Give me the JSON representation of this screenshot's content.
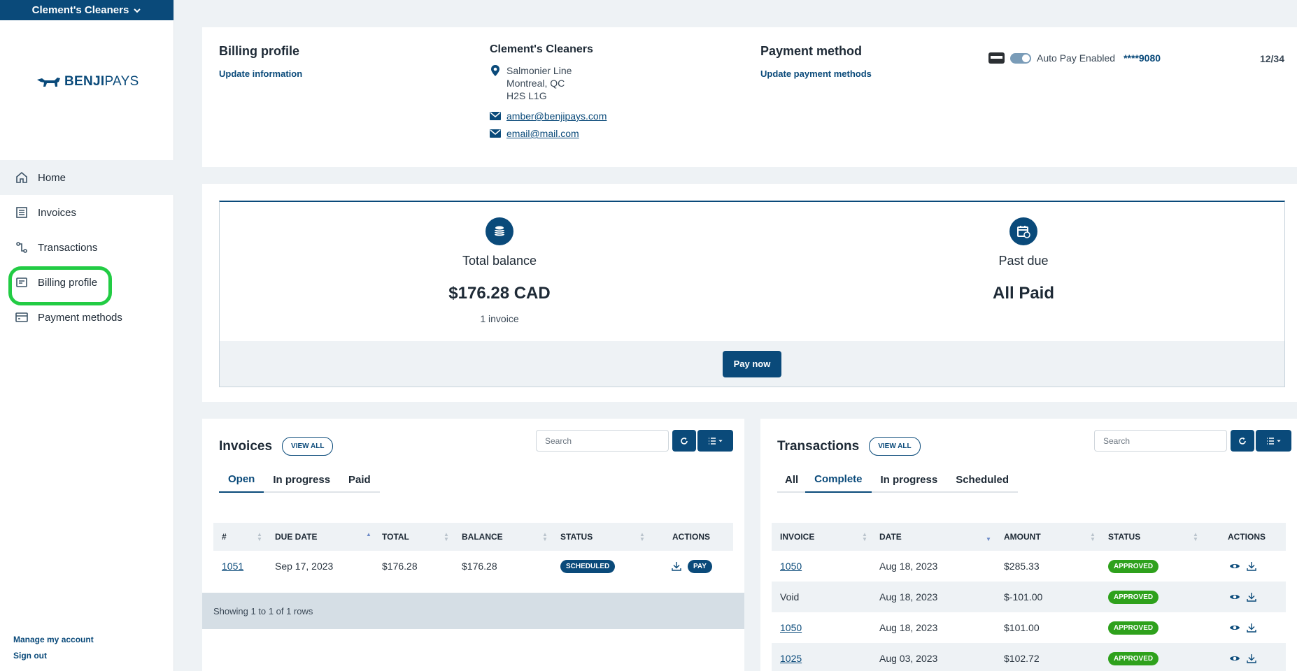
{
  "sidebar": {
    "company": "Clement's Cleaners",
    "logo_bold": "BENJI",
    "logo_light": "PAYS",
    "nav": [
      {
        "label": "Home",
        "icon": "home-icon"
      },
      {
        "label": "Invoices",
        "icon": "invoice-icon"
      },
      {
        "label": "Transactions",
        "icon": "transactions-icon"
      },
      {
        "label": "Billing profile",
        "icon": "billing-icon"
      },
      {
        "label": "Payment methods",
        "icon": "credit-card-icon"
      }
    ],
    "manage_account": "Manage my account",
    "sign_out": "Sign out"
  },
  "profile": {
    "title": "Billing profile",
    "update_info": "Update information",
    "company_name": "Clement's Cleaners",
    "address_line1": "Salmonier Line",
    "address_line2": "Montreal, QC",
    "address_line3": "H2S L1G",
    "email1": "amber@benjipays.com",
    "email2": "email@mail.com",
    "payment_title": "Payment method",
    "update_payment": "Update payment methods",
    "autopay_label": "Auto Pay Enabled",
    "card_masked": "****9080",
    "card_expiry": "12/34"
  },
  "balance": {
    "total_label": "Total balance",
    "total_value": "$176.28 CAD",
    "total_sub": "1 invoice",
    "past_due_label": "Past due",
    "past_due_value": "All Paid",
    "pay_now": "Pay now"
  },
  "invoices": {
    "title": "Invoices",
    "view_all": "VIEW ALL",
    "search_placeholder": "Search",
    "tabs": [
      "Open",
      "In progress",
      "Paid"
    ],
    "active_tab": "Open",
    "columns": [
      "#",
      "DUE DATE",
      "TOTAL",
      "BALANCE",
      "STATUS",
      "ACTIONS"
    ],
    "rows": [
      {
        "number": "1051",
        "due_date": "Sep 17, 2023",
        "total": "$176.28",
        "balance": "$176.28",
        "status": "SCHEDULED",
        "action": "PAY"
      }
    ],
    "footer": "Showing 1 to 1 of 1 rows"
  },
  "transactions": {
    "title": "Transactions",
    "view_all": "VIEW ALL",
    "search_placeholder": "Search",
    "tabs": [
      "All",
      "Complete",
      "In progress",
      "Scheduled"
    ],
    "active_tab": "Complete",
    "columns": [
      "INVOICE",
      "DATE",
      "AMOUNT",
      "STATUS",
      "ACTIONS"
    ],
    "rows": [
      {
        "invoice": "1050",
        "date": "Aug 18, 2023",
        "amount": "$285.33",
        "status": "APPROVED"
      },
      {
        "invoice": "Void",
        "date": "Aug 18, 2023",
        "amount": "$-101.00",
        "status": "APPROVED"
      },
      {
        "invoice": "1050",
        "date": "Aug 18, 2023",
        "amount": "$101.00",
        "status": "APPROVED"
      },
      {
        "invoice": "1025",
        "date": "Aug 03, 2023",
        "amount": "$102.72",
        "status": "APPROVED"
      }
    ]
  },
  "colors": {
    "brand": "#0a4a7a",
    "approved": "#2ea11c",
    "highlight": "#22cc44"
  }
}
